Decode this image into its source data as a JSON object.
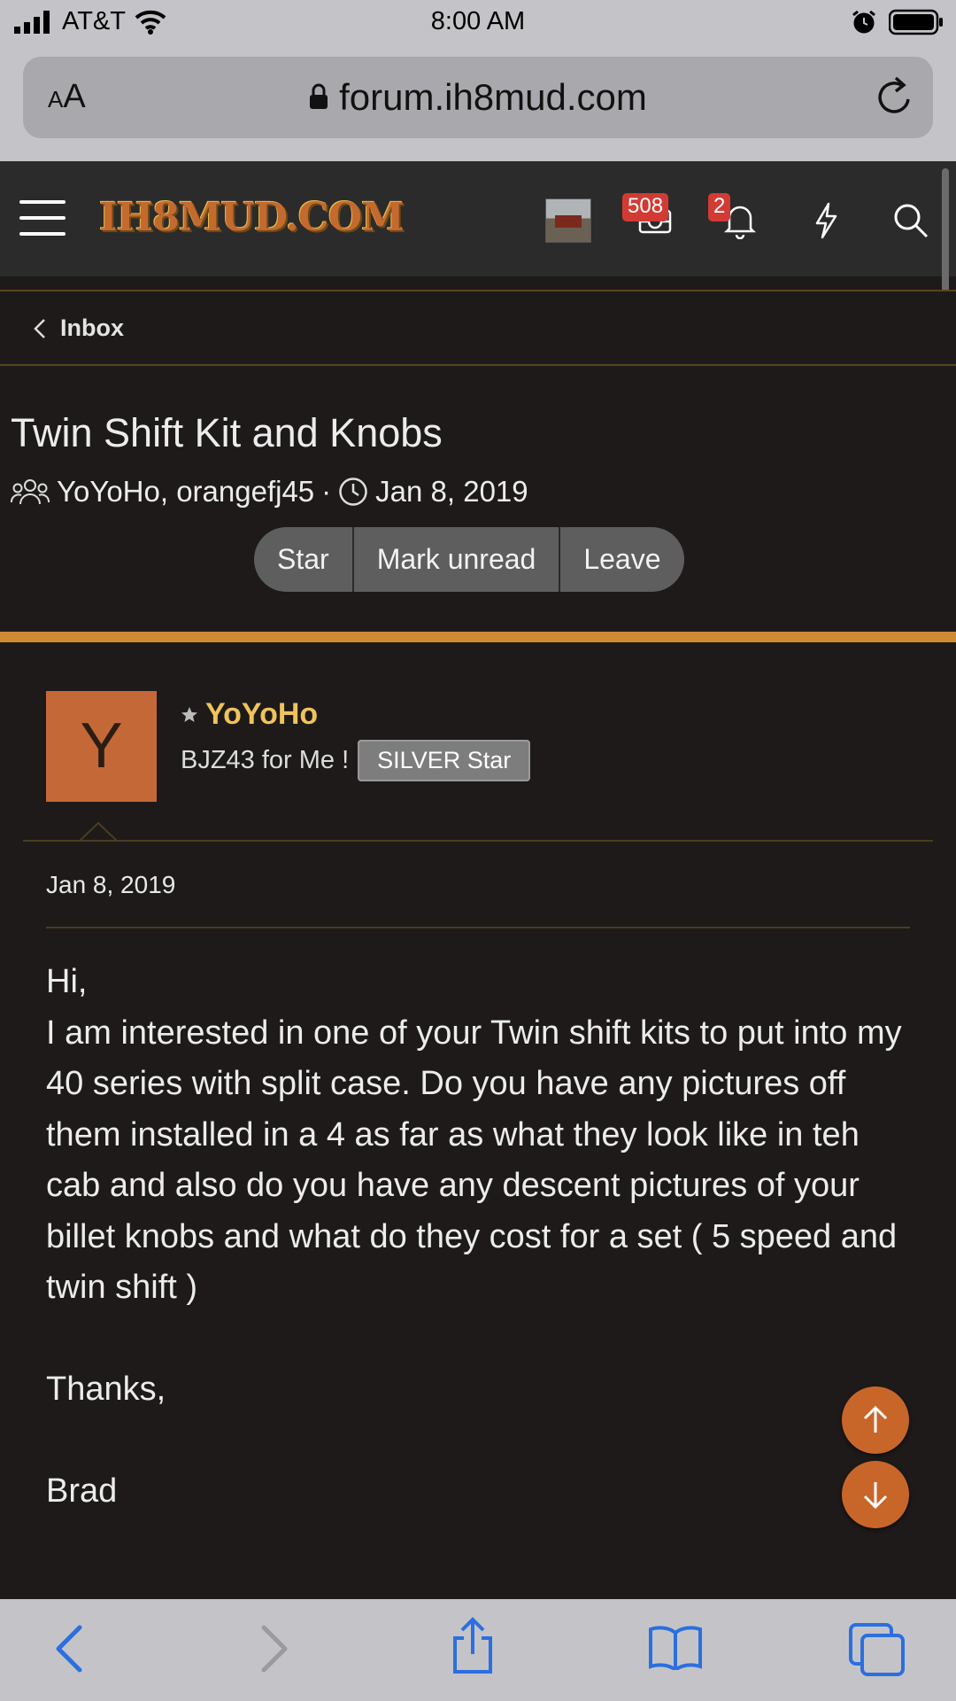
{
  "status_bar": {
    "carrier": "AT&T",
    "time": "8:00 AM"
  },
  "browser": {
    "text_size_label_small": "A",
    "text_size_label_large": "A",
    "url": "forum.ih8mud.com"
  },
  "header": {
    "logo_text": "IH8MUD.COM",
    "conversations_badge": "508",
    "alerts_badge": "2"
  },
  "breadcrumb": {
    "label": "Inbox"
  },
  "conversation": {
    "title": "Twin Shift Kit and Knobs",
    "participants": "YoYoHo, orangefj45",
    "separator": "·",
    "date": "Jan 8, 2019",
    "actions": [
      "Star",
      "Mark unread",
      "Leave"
    ]
  },
  "message": {
    "avatar_letter": "Y",
    "author": "YoYoHo",
    "user_title": "BJZ43 for Me !",
    "user_banner": "SILVER Star",
    "date": "Jan 8, 2019",
    "body": [
      "Hi,",
      "I am interested in one of your Twin shift kits to put into my 40 series with split case. Do you have any pictures off them installed in a 4 as far as what they look like in teh cab and also do you have any descent pictures of your billet knobs and what do they cost for a set ( 5 speed and twin shift )",
      "Thanks,",
      "Brad"
    ]
  },
  "colors": {
    "accent": "#d08a34",
    "username": "#f0c35a",
    "avatar_bg": "#c56838",
    "badge": "#d23b34",
    "background": "#1d1a19"
  },
  "icons": [
    "signal-icon",
    "wifi-icon",
    "alarm-icon",
    "battery-icon",
    "lock-icon",
    "reload-icon",
    "menu-icon",
    "inbox-icon",
    "bell-icon",
    "bolt-icon",
    "search-icon",
    "chevron-left-icon",
    "users-icon",
    "clock-icon",
    "star-icon",
    "arrow-up-icon",
    "arrow-down-icon",
    "back-icon",
    "forward-icon",
    "share-icon",
    "bookmarks-icon",
    "tabs-icon"
  ]
}
